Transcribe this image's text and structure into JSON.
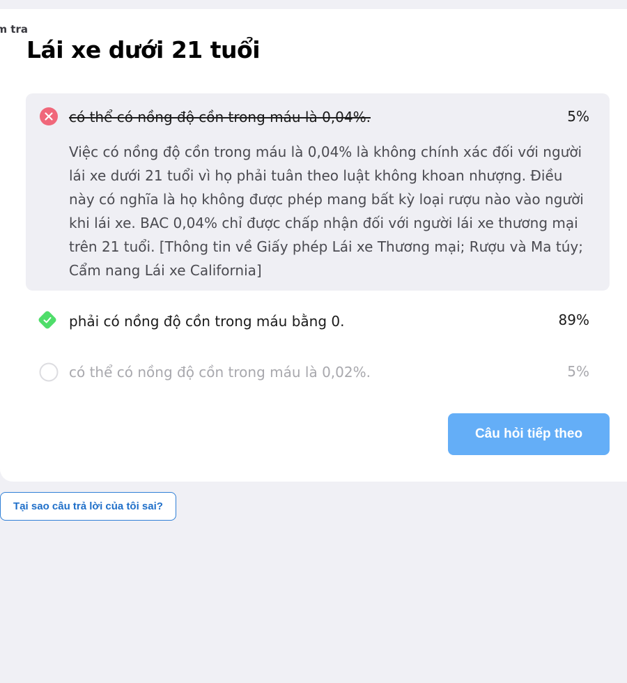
{
  "breadcrumb": "Kiểm tra",
  "question": {
    "title": "Lái xe dưới 21 tuổi"
  },
  "options": [
    {
      "text": "có thể có nồng độ cồn trong máu là 0,04%.",
      "percent": "5%",
      "status": "wrong",
      "explanation": "Việc có nồng độ cồn trong máu là 0,04% là không chính xác đối với người lái xe dưới 21 tuổi vì họ phải tuân theo luật không khoan nhượng. Điều này có nghĩa là họ không được phép mang bất kỳ loại rượu nào vào người khi lái xe. BAC 0,04% chỉ được chấp nhận đối với người lái xe thương mại trên 21 tuổi. [Thông tin về Giấy phép Lái xe Thương mại; Rượu và Ma túy; Cẩm nang Lái xe California]"
    },
    {
      "text": "phải có nồng độ cồn trong máu bằng 0.",
      "percent": "89%",
      "status": "correct"
    },
    {
      "text": "có thể có nồng độ cồn trong máu là 0,02%.",
      "percent": "5%",
      "status": "unselected"
    }
  ],
  "buttons": {
    "next": "Câu hỏi tiếp theo",
    "why_wrong": "Tại sao câu trả lời của tôi sai?"
  },
  "colors": {
    "wrong": "#f0677a",
    "correct": "#4fdd6a",
    "button_primary": "#64aef7",
    "link": "#1f6fc9",
    "highlight_bg": "#efeff4"
  },
  "icons": {
    "wrong": "x-circle-icon",
    "correct": "check-diamond-icon",
    "empty": "empty-circle-icon"
  }
}
